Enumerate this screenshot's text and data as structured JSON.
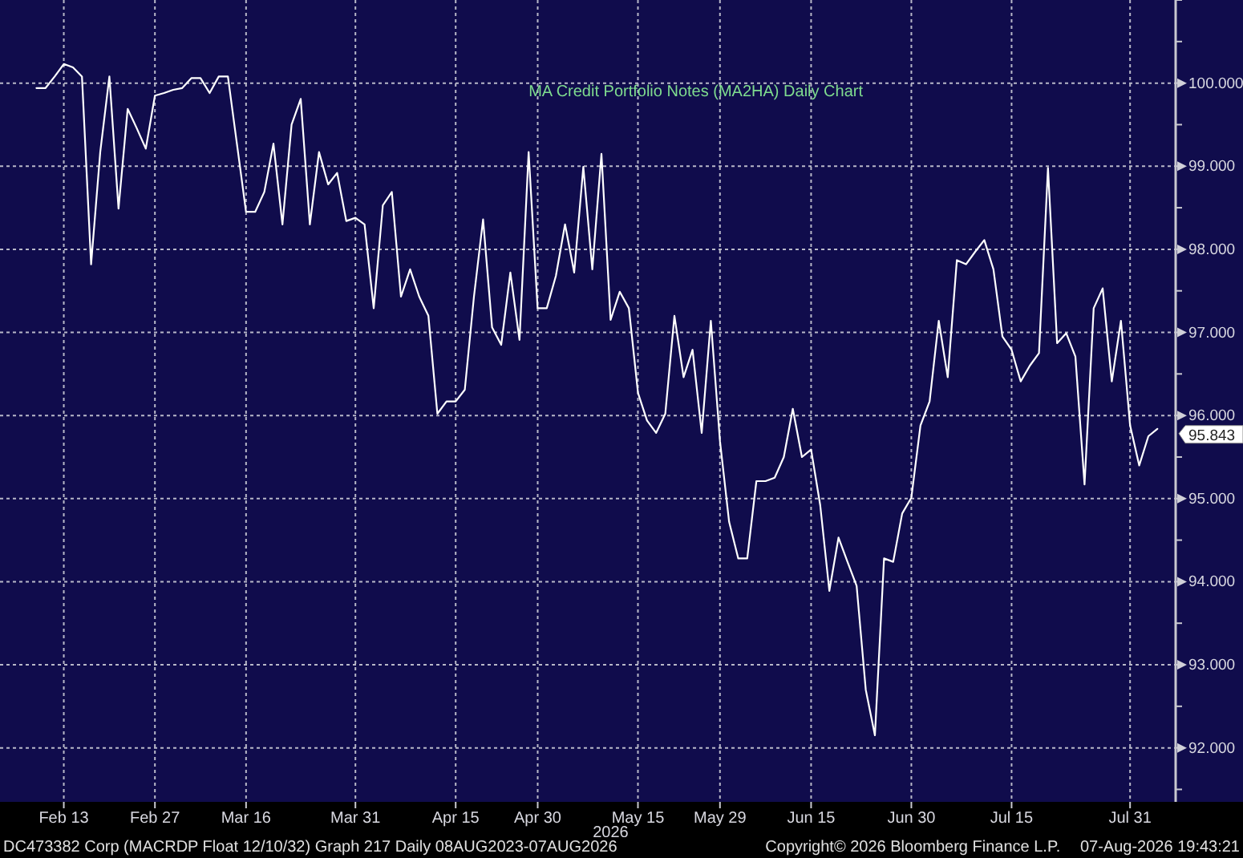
{
  "chart": {
    "title": "MA Credit Portfolio Notes (MA2HA) Daily Chart",
    "year_label": "2026",
    "last_value_label": "95.843",
    "chart_data": {
      "type": "line",
      "grid": true,
      "ylim": [
        91.35,
        101.0
      ],
      "categories": [
        null,
        null,
        null,
        "Feb 13",
        null,
        null,
        null,
        null,
        null,
        null,
        null,
        null,
        null,
        "Feb 27",
        null,
        null,
        null,
        null,
        null,
        null,
        null,
        null,
        null,
        "Mar 16",
        null,
        null,
        null,
        null,
        null,
        null,
        null,
        null,
        null,
        null,
        null,
        "Mar 31",
        null,
        null,
        null,
        null,
        null,
        null,
        null,
        null,
        null,
        null,
        "Apr 15",
        null,
        null,
        null,
        null,
        null,
        null,
        null,
        null,
        "Apr 30",
        null,
        null,
        null,
        null,
        null,
        null,
        null,
        null,
        null,
        null,
        "May 15",
        null,
        null,
        null,
        null,
        null,
        null,
        null,
        null,
        "May 29",
        null,
        null,
        null,
        null,
        null,
        null,
        null,
        null,
        null,
        "Jun 15",
        null,
        null,
        null,
        null,
        null,
        null,
        null,
        null,
        null,
        null,
        "Jun 30",
        null,
        null,
        null,
        null,
        null,
        null,
        null,
        null,
        null,
        null,
        "Jul 15",
        null,
        null,
        null,
        null,
        null,
        null,
        null,
        null,
        null,
        null,
        null,
        null,
        "Jul 31",
        null,
        null,
        null
      ],
      "yticks": [
        {
          "value": 92,
          "label": "92.000"
        },
        {
          "value": 93,
          "label": "93.000"
        },
        {
          "value": 94,
          "label": "94.000"
        },
        {
          "value": 95,
          "label": "95.000"
        },
        {
          "value": 96,
          "label": "96.000"
        },
        {
          "value": 97,
          "label": "97.000"
        },
        {
          "value": 98,
          "label": "98.000"
        },
        {
          "value": 99,
          "label": "99.000"
        },
        {
          "value": 100,
          "label": "100.000"
        }
      ],
      "series": [
        {
          "color": "#ffffff",
          "values": [
            99.94,
            99.94,
            100.08,
            100.23,
            100.19,
            100.08,
            97.82,
            99.17,
            100.08,
            98.49,
            99.69,
            99.46,
            99.21,
            99.85,
            99.88,
            99.92,
            99.94,
            100.06,
            100.06,
            99.88,
            100.08,
            100.08,
            99.27,
            98.45,
            98.45,
            98.69,
            99.27,
            98.3,
            99.5,
            99.81,
            98.3,
            99.17,
            98.78,
            98.92,
            98.34,
            98.38,
            98.3,
            97.29,
            98.53,
            98.69,
            97.43,
            97.76,
            97.43,
            97.2,
            96.02,
            96.17,
            96.17,
            96.31,
            97.43,
            98.36,
            97.06,
            96.85,
            97.72,
            96.91,
            99.17,
            97.29,
            97.29,
            97.68,
            98.3,
            97.72,
            98.99,
            97.76,
            99.15,
            97.15,
            97.49,
            97.29,
            96.27,
            95.94,
            95.79,
            96.02,
            97.2,
            96.46,
            96.79,
            95.79,
            97.14,
            95.69,
            94.72,
            94.28,
            94.28,
            95.21,
            95.21,
            95.25,
            95.5,
            96.08,
            95.5,
            95.59,
            94.92,
            93.89,
            94.53,
            94.24,
            93.95,
            92.7,
            92.15,
            94.28,
            94.24,
            94.82,
            95.01,
            95.88,
            96.17,
            97.14,
            96.46,
            97.87,
            97.82,
            97.97,
            98.11,
            97.76,
            96.95,
            96.79,
            96.41,
            96.6,
            96.75,
            98.98,
            96.87,
            96.99,
            96.71,
            95.17,
            97.29,
            97.53,
            96.41,
            97.14,
            95.88,
            95.4,
            95.75,
            95.84
          ]
        }
      ]
    }
  },
  "footer": {
    "left": "DC473382 Corp (MACRDP Float 12/10/32) Graph 217 Daily 08AUG2023-07AUG2026",
    "center": "Copyright© 2026 Bloomberg Finance L.P.",
    "right": "07-Aug-2026 19:43:21"
  }
}
